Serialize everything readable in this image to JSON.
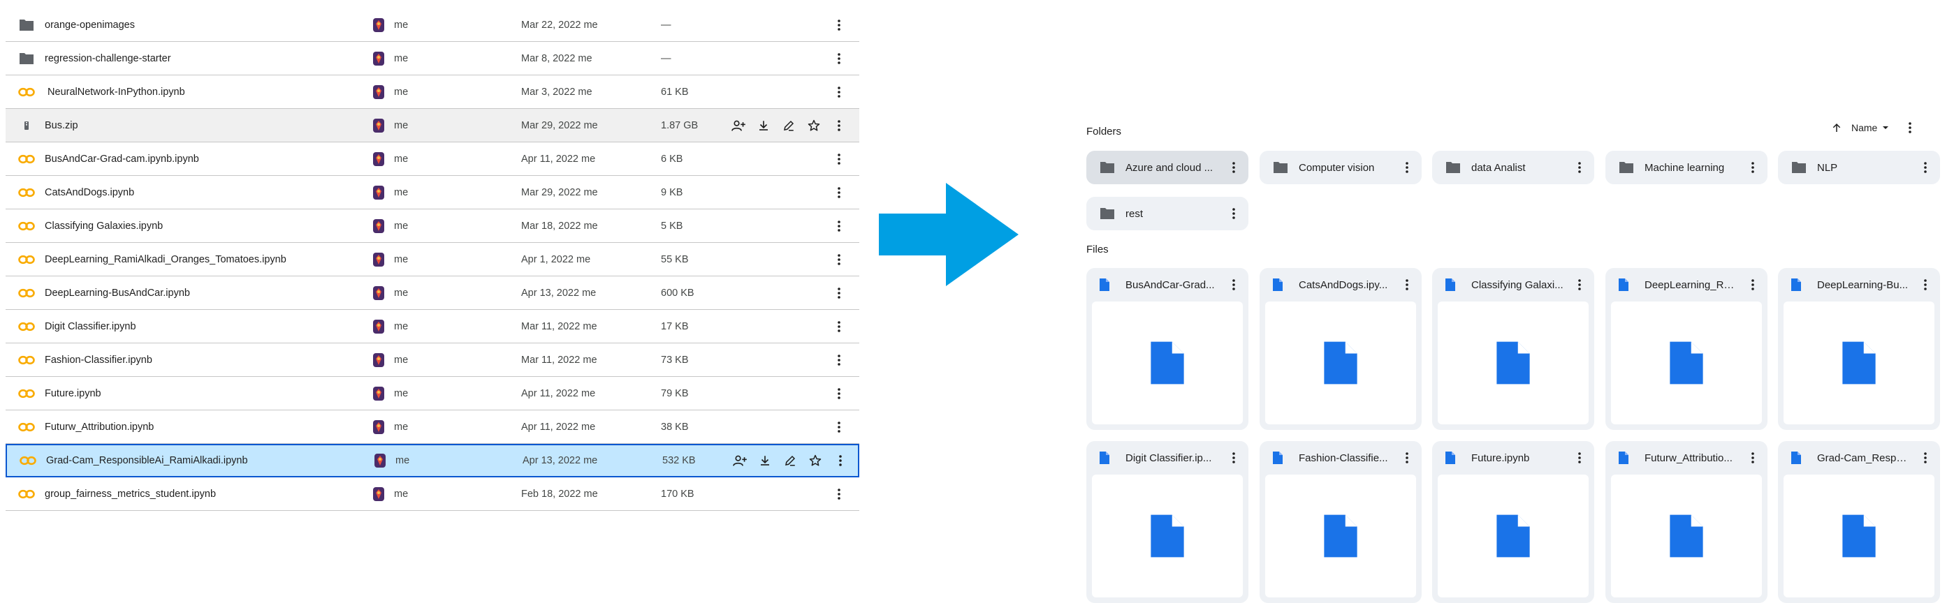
{
  "list_view": {
    "rows": [
      {
        "name": "orange-openimages",
        "kind": "folder",
        "owner": "me",
        "modified": "Mar 22, 2022 me",
        "size": "—",
        "state": "normal"
      },
      {
        "name": "regression-challenge-starter",
        "kind": "folder",
        "owner": "me",
        "modified": "Mar 8, 2022 me",
        "size": "—",
        "state": "normal"
      },
      {
        "name": " NeuralNetwork-InPython.ipynb",
        "kind": "colab",
        "owner": "me",
        "modified": "Mar 3, 2022 me",
        "size": "61 KB",
        "state": "normal"
      },
      {
        "name": "Bus.zip",
        "kind": "zip",
        "owner": "me",
        "modified": "Mar 29, 2022 me",
        "size": "1.87 GB",
        "state": "hovered"
      },
      {
        "name": "BusAndCar-Grad-cam.ipynb.ipynb",
        "kind": "colab",
        "owner": "me",
        "modified": "Apr 11, 2022 me",
        "size": "6 KB",
        "state": "normal"
      },
      {
        "name": "CatsAndDogs.ipynb",
        "kind": "colab",
        "owner": "me",
        "modified": "Mar 29, 2022 me",
        "size": "9 KB",
        "state": "normal"
      },
      {
        "name": "Classifying Galaxies.ipynb",
        "kind": "colab",
        "owner": "me",
        "modified": "Mar 18, 2022 me",
        "size": "5 KB",
        "state": "normal"
      },
      {
        "name": "DeepLearning_RamiAlkadi_Oranges_Tomatoes.ipynb",
        "kind": "colab",
        "owner": "me",
        "modified": "Apr 1, 2022 me",
        "size": "55 KB",
        "state": "normal"
      },
      {
        "name": "DeepLearning-BusAndCar.ipynb",
        "kind": "colab",
        "owner": "me",
        "modified": "Apr 13, 2022 me",
        "size": "600 KB",
        "state": "normal"
      },
      {
        "name": "Digit Classifier.ipynb",
        "kind": "colab",
        "owner": "me",
        "modified": "Mar 11, 2022 me",
        "size": "17 KB",
        "state": "normal"
      },
      {
        "name": "Fashion-Classifier.ipynb",
        "kind": "colab",
        "owner": "me",
        "modified": "Mar 11, 2022 me",
        "size": "73 KB",
        "state": "normal"
      },
      {
        "name": "Future.ipynb",
        "kind": "colab",
        "owner": "me",
        "modified": "Apr 11, 2022 me",
        "size": "79 KB",
        "state": "normal"
      },
      {
        "name": "Futurw_Attribution.ipynb",
        "kind": "colab",
        "owner": "me",
        "modified": "Apr 11, 2022 me",
        "size": "38 KB",
        "state": "normal"
      },
      {
        "name": "Grad-Cam_ResponsibleAi_RamiAlkadi.ipynb",
        "kind": "colab",
        "owner": "me",
        "modified": "Apr 13, 2022 me",
        "size": "532 KB",
        "state": "selected"
      },
      {
        "name": "group_fairness_metrics_student.ipynb",
        "kind": "colab",
        "owner": "me",
        "modified": "Feb 18, 2022 me",
        "size": "170 KB",
        "state": "normal"
      }
    ],
    "row_action_icons": [
      "share-person-icon",
      "download-icon",
      "rename-pencil-icon",
      "star-icon"
    ],
    "more_icon": "more-vertical-icon"
  },
  "grid_view": {
    "folders_title": "Folders",
    "files_title": "Files",
    "sort_label": "Name",
    "sort_direction_icon": "arrow-up-icon",
    "folders": [
      {
        "label": "Azure and cloud ...",
        "state": "hovered"
      },
      {
        "label": "Computer vision",
        "state": "normal"
      },
      {
        "label": "data Analist",
        "state": "normal"
      },
      {
        "label": "Machine learning",
        "state": "normal"
      },
      {
        "label": "NLP",
        "state": "normal"
      },
      {
        "label": "rest",
        "state": "normal"
      }
    ],
    "files": [
      {
        "label": "BusAndCar-Grad..."
      },
      {
        "label": "CatsAndDogs.ipy..."
      },
      {
        "label": "Classifying Galaxi..."
      },
      {
        "label": "DeepLearning_Ra..."
      },
      {
        "label": "DeepLearning-Bu..."
      },
      {
        "label": "Digit Classifier.ip..."
      },
      {
        "label": "Fashion-Classifie..."
      },
      {
        "label": "Future.ipynb"
      },
      {
        "label": "Futurw_Attributio..."
      },
      {
        "label": "Grad-Cam_Respo..."
      }
    ]
  },
  "colors": {
    "arrow": "#009fe3",
    "selected_row_bg": "#c2e7ff",
    "selected_row_border": "#0b57d0",
    "doc_blue": "#1a73e8",
    "colab_orange": "#f9ab00",
    "folder_gray": "#5f6368",
    "chip_bg": "#eef1f5"
  }
}
